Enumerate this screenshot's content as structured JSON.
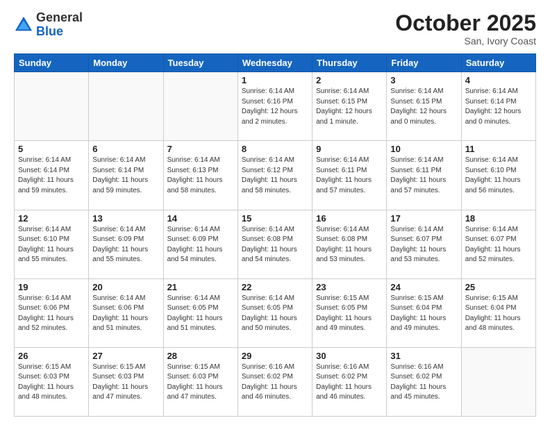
{
  "header": {
    "logo_general": "General",
    "logo_blue": "Blue",
    "month_title": "October 2025",
    "subtitle": "San, Ivory Coast"
  },
  "days_of_week": [
    "Sunday",
    "Monday",
    "Tuesday",
    "Wednesday",
    "Thursday",
    "Friday",
    "Saturday"
  ],
  "weeks": [
    [
      {
        "day": "",
        "info": ""
      },
      {
        "day": "",
        "info": ""
      },
      {
        "day": "",
        "info": ""
      },
      {
        "day": "1",
        "info": "Sunrise: 6:14 AM\nSunset: 6:16 PM\nDaylight: 12 hours\nand 2 minutes."
      },
      {
        "day": "2",
        "info": "Sunrise: 6:14 AM\nSunset: 6:15 PM\nDaylight: 12 hours\nand 1 minute."
      },
      {
        "day": "3",
        "info": "Sunrise: 6:14 AM\nSunset: 6:15 PM\nDaylight: 12 hours\nand 0 minutes."
      },
      {
        "day": "4",
        "info": "Sunrise: 6:14 AM\nSunset: 6:14 PM\nDaylight: 12 hours\nand 0 minutes."
      }
    ],
    [
      {
        "day": "5",
        "info": "Sunrise: 6:14 AM\nSunset: 6:14 PM\nDaylight: 11 hours\nand 59 minutes."
      },
      {
        "day": "6",
        "info": "Sunrise: 6:14 AM\nSunset: 6:14 PM\nDaylight: 11 hours\nand 59 minutes."
      },
      {
        "day": "7",
        "info": "Sunrise: 6:14 AM\nSunset: 6:13 PM\nDaylight: 11 hours\nand 58 minutes."
      },
      {
        "day": "8",
        "info": "Sunrise: 6:14 AM\nSunset: 6:12 PM\nDaylight: 11 hours\nand 58 minutes."
      },
      {
        "day": "9",
        "info": "Sunrise: 6:14 AM\nSunset: 6:11 PM\nDaylight: 11 hours\nand 57 minutes."
      },
      {
        "day": "10",
        "info": "Sunrise: 6:14 AM\nSunset: 6:11 PM\nDaylight: 11 hours\nand 57 minutes."
      },
      {
        "day": "11",
        "info": "Sunrise: 6:14 AM\nSunset: 6:10 PM\nDaylight: 11 hours\nand 56 minutes."
      }
    ],
    [
      {
        "day": "12",
        "info": "Sunrise: 6:14 AM\nSunset: 6:10 PM\nDaylight: 11 hours\nand 55 minutes."
      },
      {
        "day": "13",
        "info": "Sunrise: 6:14 AM\nSunset: 6:09 PM\nDaylight: 11 hours\nand 55 minutes."
      },
      {
        "day": "14",
        "info": "Sunrise: 6:14 AM\nSunset: 6:09 PM\nDaylight: 11 hours\nand 54 minutes."
      },
      {
        "day": "15",
        "info": "Sunrise: 6:14 AM\nSunset: 6:08 PM\nDaylight: 11 hours\nand 54 minutes."
      },
      {
        "day": "16",
        "info": "Sunrise: 6:14 AM\nSunset: 6:08 PM\nDaylight: 11 hours\nand 53 minutes."
      },
      {
        "day": "17",
        "info": "Sunrise: 6:14 AM\nSunset: 6:07 PM\nDaylight: 11 hours\nand 53 minutes."
      },
      {
        "day": "18",
        "info": "Sunrise: 6:14 AM\nSunset: 6:07 PM\nDaylight: 11 hours\nand 52 minutes."
      }
    ],
    [
      {
        "day": "19",
        "info": "Sunrise: 6:14 AM\nSunset: 6:06 PM\nDaylight: 11 hours\nand 52 minutes."
      },
      {
        "day": "20",
        "info": "Sunrise: 6:14 AM\nSunset: 6:06 PM\nDaylight: 11 hours\nand 51 minutes."
      },
      {
        "day": "21",
        "info": "Sunrise: 6:14 AM\nSunset: 6:05 PM\nDaylight: 11 hours\nand 51 minutes."
      },
      {
        "day": "22",
        "info": "Sunrise: 6:14 AM\nSunset: 6:05 PM\nDaylight: 11 hours\nand 50 minutes."
      },
      {
        "day": "23",
        "info": "Sunrise: 6:15 AM\nSunset: 6:05 PM\nDaylight: 11 hours\nand 49 minutes."
      },
      {
        "day": "24",
        "info": "Sunrise: 6:15 AM\nSunset: 6:04 PM\nDaylight: 11 hours\nand 49 minutes."
      },
      {
        "day": "25",
        "info": "Sunrise: 6:15 AM\nSunset: 6:04 PM\nDaylight: 11 hours\nand 48 minutes."
      }
    ],
    [
      {
        "day": "26",
        "info": "Sunrise: 6:15 AM\nSunset: 6:03 PM\nDaylight: 11 hours\nand 48 minutes."
      },
      {
        "day": "27",
        "info": "Sunrise: 6:15 AM\nSunset: 6:03 PM\nDaylight: 11 hours\nand 47 minutes."
      },
      {
        "day": "28",
        "info": "Sunrise: 6:15 AM\nSunset: 6:03 PM\nDaylight: 11 hours\nand 47 minutes."
      },
      {
        "day": "29",
        "info": "Sunrise: 6:16 AM\nSunset: 6:02 PM\nDaylight: 11 hours\nand 46 minutes."
      },
      {
        "day": "30",
        "info": "Sunrise: 6:16 AM\nSunset: 6:02 PM\nDaylight: 11 hours\nand 46 minutes."
      },
      {
        "day": "31",
        "info": "Sunrise: 6:16 AM\nSunset: 6:02 PM\nDaylight: 11 hours\nand 45 minutes."
      },
      {
        "day": "",
        "info": ""
      }
    ]
  ]
}
